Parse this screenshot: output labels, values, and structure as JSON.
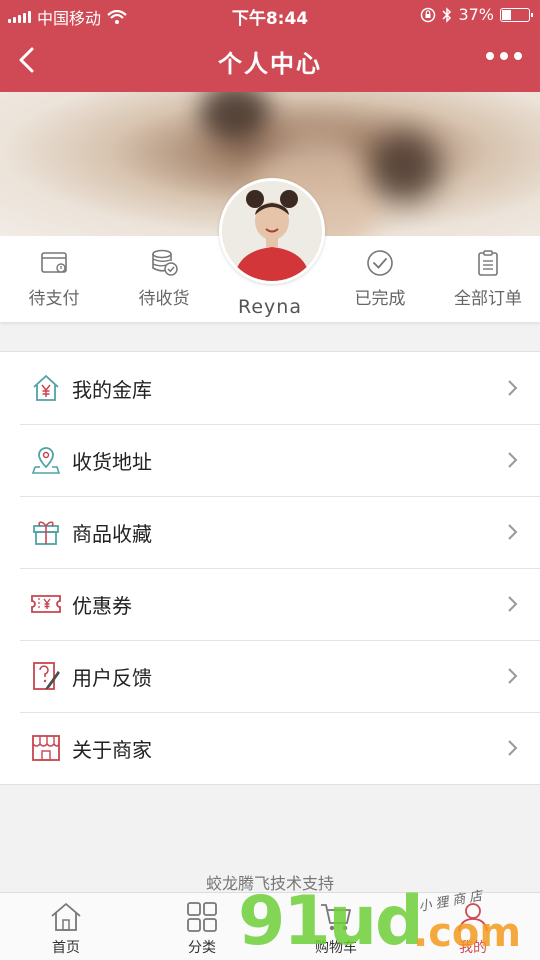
{
  "status_bar": {
    "carrier": "中国移动",
    "time": "下午8:44",
    "battery_percent": "37%",
    "battery_level": 0.37
  },
  "nav": {
    "title": "个人中心"
  },
  "profile": {
    "username": "Reyna"
  },
  "orders": [
    {
      "label": "待支付",
      "icon": "wallet-card-icon"
    },
    {
      "label": "待收货",
      "icon": "coins-check-icon"
    },
    {
      "label": "已完成",
      "icon": "check-circle-icon"
    },
    {
      "label": "全部订单",
      "icon": "clipboard-icon"
    }
  ],
  "menu": [
    {
      "label": "我的金库",
      "icon": "yen-house-icon"
    },
    {
      "label": "收货地址",
      "icon": "map-pin-icon"
    },
    {
      "label": "商品收藏",
      "icon": "gift-icon"
    },
    {
      "label": "优惠券",
      "icon": "coupon-icon"
    },
    {
      "label": "用户反馈",
      "icon": "feedback-icon"
    },
    {
      "label": "关于商家",
      "icon": "store-icon"
    }
  ],
  "footer": {
    "support_text": "蛟龙腾飞技术支持"
  },
  "tabbar": [
    {
      "label": "首页",
      "icon": "home-icon"
    },
    {
      "label": "分类",
      "icon": "grid-icon"
    },
    {
      "label": "购物车",
      "icon": "cart-icon"
    },
    {
      "label": "我的",
      "icon": "user-icon"
    }
  ],
  "watermark": {
    "brand": "91ud",
    "domain": ".com",
    "handwritten": "小狸商店"
  },
  "colors": {
    "primary": "#cf4a55",
    "icon_accent": "#c9454f",
    "icon_teal": "#4fa3a5"
  }
}
